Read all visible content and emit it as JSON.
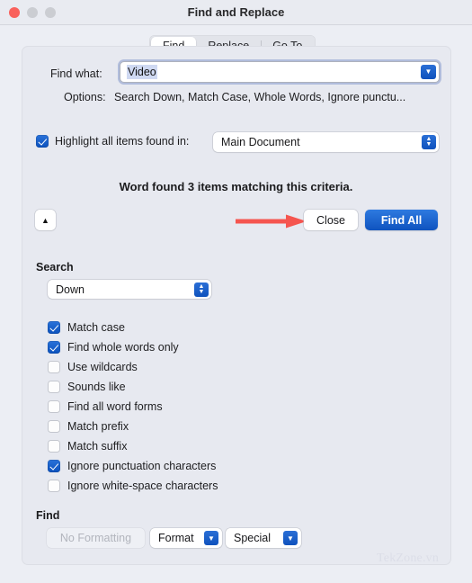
{
  "window": {
    "title": "Find and Replace",
    "traffic_lights": [
      "close",
      "minimize",
      "maximize"
    ],
    "accent_blue": "#0f52bd",
    "annotation_red": "#f5554f"
  },
  "tabs": [
    {
      "label": "Find",
      "active": true
    },
    {
      "label": "Replace",
      "active": false
    },
    {
      "label": "Go To",
      "active": false
    }
  ],
  "find_row": {
    "label": "Find what:",
    "value": "Video",
    "placeholder": "",
    "dropdown_icon": "chevron-down-icon"
  },
  "options_row": {
    "label": "Options:",
    "value": "Search Down, Match Case, Whole Words, Ignore punctu..."
  },
  "highlight_row": {
    "checked": true,
    "label": "Highlight all items found in:",
    "selected": "Main Document",
    "stepper_icon": "up-down-chevron-icon"
  },
  "result": {
    "text": "Word found 3 items matching this criteria."
  },
  "buttons": {
    "collapse_icon": "chevron-up-icon",
    "close": "Close",
    "find_all": "Find All"
  },
  "search_section": {
    "heading": "Search",
    "direction": "Down",
    "stepper_icon": "up-down-chevron-icon",
    "checkboxes": [
      {
        "label": "Match case",
        "checked": true
      },
      {
        "label": "Find whole words only",
        "checked": true
      },
      {
        "label": "Use wildcards",
        "checked": false
      },
      {
        "label": "Sounds like",
        "checked": false
      },
      {
        "label": "Find all word forms",
        "checked": false
      },
      {
        "label": "Match prefix",
        "checked": false
      },
      {
        "label": "Match suffix",
        "checked": false
      },
      {
        "label": "Ignore punctuation characters",
        "checked": true
      },
      {
        "label": "Ignore white-space characters",
        "checked": false
      }
    ]
  },
  "find_section": {
    "heading": "Find",
    "no_formatting": "No Formatting",
    "format": "Format",
    "special": "Special",
    "format_icon": "chevron-down-icon",
    "special_icon": "chevron-down-icon"
  },
  "watermark": {
    "text": "TekZone.vn"
  }
}
